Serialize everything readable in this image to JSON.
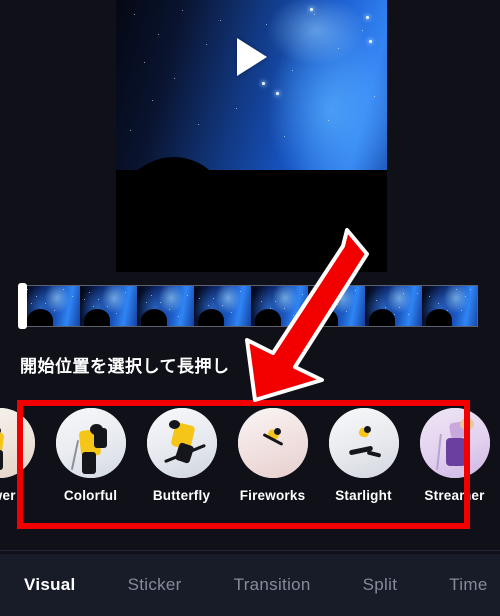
{
  "app": {
    "background_color": "#0f1018",
    "accent_color": "#f20000",
    "tabbar_color": "#181b28"
  },
  "preview": {
    "play_icon": "play-triangle-icon",
    "scene_description": "night sky galaxy with tree silhouette"
  },
  "timeline": {
    "playhead_label": "playhead-handle",
    "frame_count": 8
  },
  "hint": {
    "text": "開始位置を選択して長押し"
  },
  "effects": {
    "items": [
      {
        "label": "ower",
        "thumb": "skier-flower-thumb"
      },
      {
        "label": "Colorful",
        "thumb": "skier-colorful-thumb"
      },
      {
        "label": "Butterfly",
        "thumb": "skier-butterfly-thumb"
      },
      {
        "label": "Fireworks",
        "thumb": "skier-fireworks-thumb"
      },
      {
        "label": "Starlight",
        "thumb": "skier-starlight-thumb"
      },
      {
        "label": "Streamer",
        "thumb": "skier-streamer-thumb"
      }
    ]
  },
  "annotations": {
    "highlight_box_color": "#f20000",
    "arrow_color": "#f20000",
    "arrow_outline_color": "#ffffff"
  },
  "tabs": [
    {
      "label": "Visual",
      "active": true
    },
    {
      "label": "Sticker",
      "active": false
    },
    {
      "label": "Transition",
      "active": false
    },
    {
      "label": "Split",
      "active": false
    },
    {
      "label": "Time",
      "active": false
    }
  ]
}
